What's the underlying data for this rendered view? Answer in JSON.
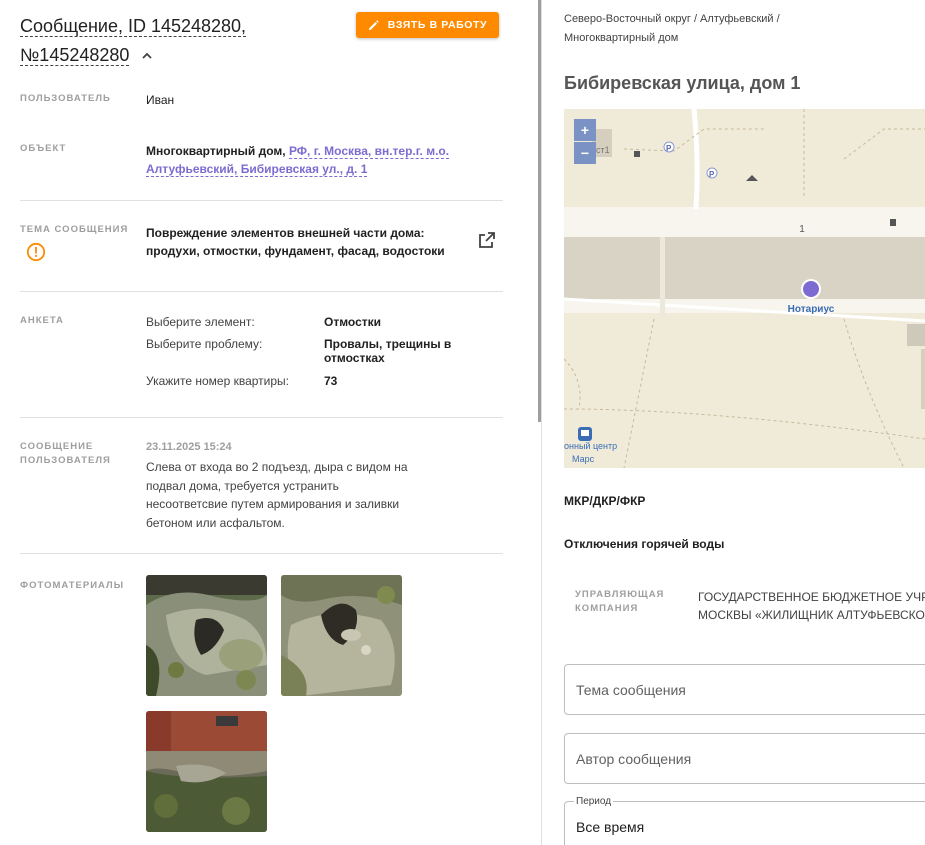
{
  "message": {
    "title": "Сообщение, ID 145248280, №145248280",
    "take_button": "ВЗЯТЬ В РАБОТУ"
  },
  "fields": {
    "user_label": "ПОЛЬЗОВАТЕЛЬ",
    "user_value": "Иван",
    "object_label": "ОБЪЕКТ",
    "object_type": "Многоквартирный дом,",
    "object_link": "РФ, г. Москва, вн.тер.г. м.о. Алтуфьевский, Бибиревская ул., д. 1",
    "topic_label": "ТЕМА СООБЩЕНИЯ",
    "topic_value": "Повреждение элементов внешней части дома: продухи, отмостки, фундамент, фасад, водостоки",
    "survey_label": "АНКЕТА",
    "survey": [
      {
        "key": "Выберите элемент:",
        "value": "Отмостки"
      },
      {
        "key": "Выберите проблему:",
        "value": "Провалы, трещины в отмостках"
      },
      {
        "key": "Укажите номер квартиры:",
        "value": "73"
      }
    ],
    "user_msg_label_1": "СООБЩЕНИЕ",
    "user_msg_label_2": "ПОЛЬЗОВАТЕЛЯ",
    "msg_date": "23.11.2025 15:24",
    "msg_text": "Слева от входа во 2 подъезд, дыра с видом на подвал дома, требуется устранить несоответсвие путем армирования и заливки бетоном или асфальтом.",
    "photos_label": "ФОТОМАТЕРИАЛЫ"
  },
  "right": {
    "breadcrumb": "Северо-Восточный округ / Алтуфьевский / Многоквартирный дом",
    "address": "Бибиревская улица, дом 1",
    "map": {
      "zoom_in": "+",
      "zoom_out": "−",
      "building_number": "1",
      "marker_label": "Нотариус",
      "poi_1": "онный центр",
      "poi_2": "Марс",
      "parking": "P",
      "building_label": "ст1"
    },
    "program": "МКР/ДКР/ФКР",
    "hot_water": "Отключения горячей воды",
    "uk_label_1": "УПРАВЛЯЮЩАЯ",
    "uk_label_2": "КОМПАНИЯ",
    "uk_value_1": "ГОСУДАРСТВЕННОЕ БЮДЖЕТНОЕ УЧРЕ",
    "uk_value_2": "МОСКВЫ «ЖИЛИЩНИК АЛТУФЬЕВСКО",
    "topic_placeholder": "Тема сообщения",
    "author_placeholder": "Автор сообщения",
    "period_label": "Период",
    "period_value": "Все время"
  },
  "colors": {
    "accent_orange": "#ff8a00",
    "link_purple": "#7e6bd1",
    "map_marker": "#7e6bd1",
    "map_bg": "#f0ebd9"
  }
}
